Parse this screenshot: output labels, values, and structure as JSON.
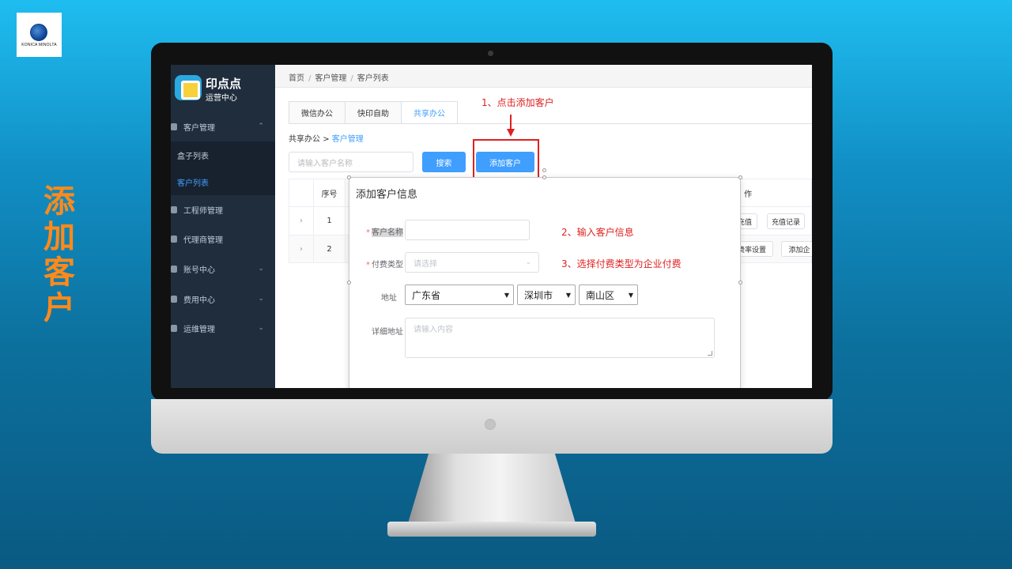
{
  "slide": {
    "title": "添加客户",
    "logo_text": "KONICA MINOLTA",
    "accent_color": "#ff8a1a",
    "annotation_color": "#e02020"
  },
  "app": {
    "brand_name": "印点点",
    "brand_sub": "运营中心",
    "sidebar": {
      "items": [
        {
          "label": "客户管理",
          "icon": "user-icon",
          "chevron": "⌃"
        },
        {
          "label": "工程师管理",
          "icon": "user-icon",
          "chevron": ""
        },
        {
          "label": "代理商管理",
          "icon": "user-icon",
          "chevron": ""
        },
        {
          "label": "账号中心",
          "icon": "list-icon",
          "chevron": "⌄"
        },
        {
          "label": "费用中心",
          "icon": "coin-icon",
          "chevron": "⌄"
        },
        {
          "label": "运维管理",
          "icon": "gear-icon",
          "chevron": "⌄"
        }
      ],
      "subitems": [
        {
          "label": "盒子列表",
          "active": false
        },
        {
          "label": "客户列表",
          "active": true
        }
      ]
    },
    "breadcrumb": [
      "首页",
      "客户管理",
      "客户列表"
    ],
    "breadcrumb_sep": "/",
    "tabs": [
      {
        "label": "微信办公",
        "active": false
      },
      {
        "label": "快印自助",
        "active": false
      },
      {
        "label": "共享办公",
        "active": true
      }
    ],
    "subcrumb": {
      "parent": "共享办公",
      "sep": ">",
      "current": "客户管理"
    },
    "search": {
      "placeholder": "请输入客户名称",
      "button": "搜索"
    },
    "add_button": "添加客户",
    "table": {
      "headers": {
        "index": "序号",
        "actions": "作"
      },
      "rows": [
        {
          "expand": "›",
          "index": "1",
          "actions": [
            "充值",
            "充值记录"
          ]
        },
        {
          "expand": "›",
          "index": "2",
          "actions": [
            "费率设置",
            "添加企"
          ]
        }
      ]
    },
    "dialog": {
      "title": "添加客户信息",
      "name_label": "客户名称",
      "name_value": "",
      "pay_label": "付费类型",
      "pay_placeholder": "请选择",
      "address_label": "地址",
      "province": "广东省",
      "city": "深圳市",
      "district": "南山区",
      "detail_label": "详细地址",
      "detail_placeholder": "请输入内容",
      "required_mark": "*"
    }
  },
  "annotations": {
    "step1": "1、点击添加客户",
    "step2": "2、输入客户信息",
    "step3": "3、选择付费类型为企业付费"
  }
}
